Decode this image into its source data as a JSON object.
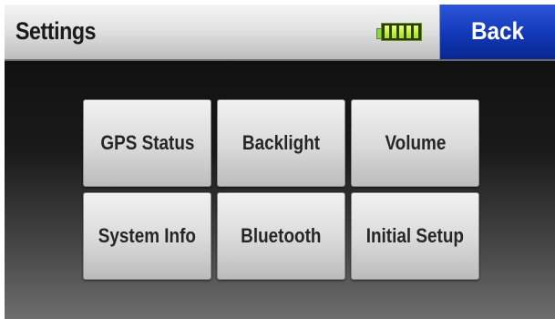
{
  "header": {
    "title": "Settings",
    "back_label": "Back",
    "battery_level": 1.0
  },
  "menu": {
    "items": [
      {
        "label": "GPS Status"
      },
      {
        "label": "Backlight"
      },
      {
        "label": "Volume"
      },
      {
        "label": "System Info"
      },
      {
        "label": "Bluetooth"
      },
      {
        "label": "Initial Setup"
      }
    ]
  },
  "colors": {
    "back_button": "#1238b8",
    "battery": "#a6e01a",
    "tile": "#dcdcdc"
  }
}
